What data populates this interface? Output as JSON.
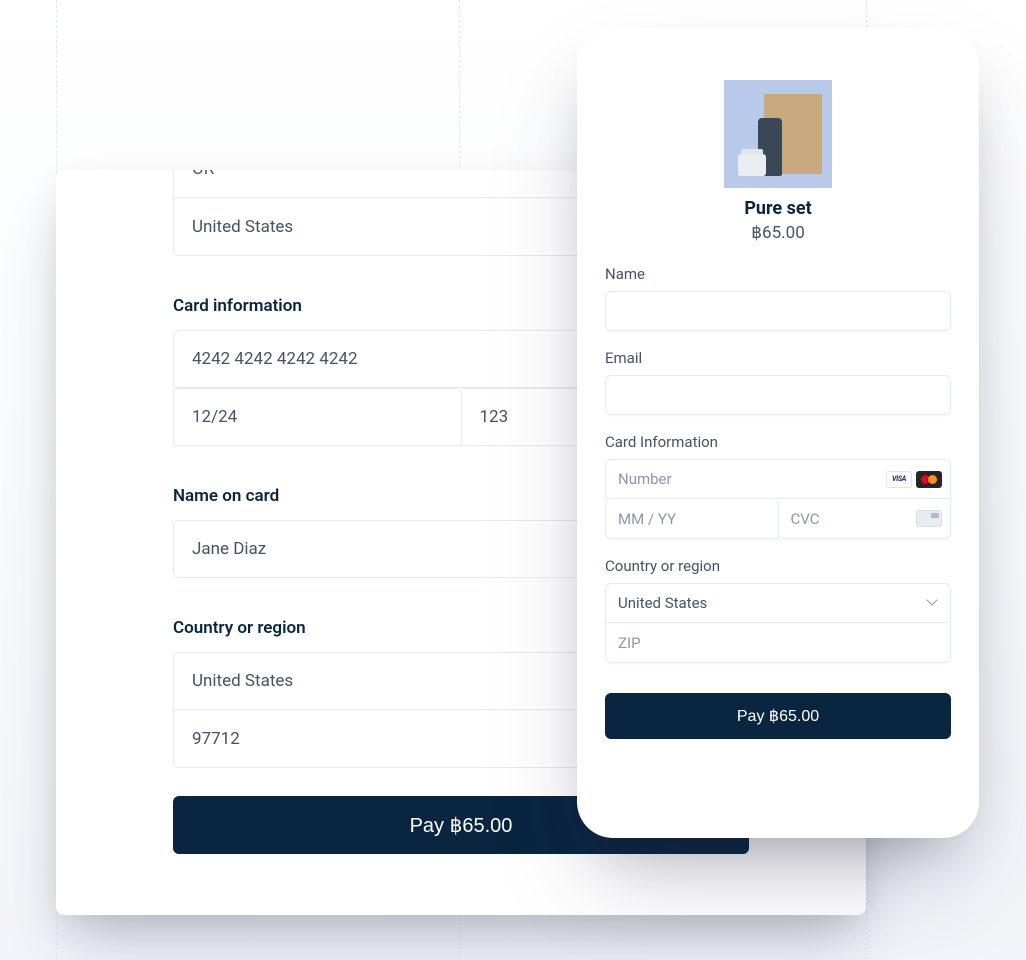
{
  "desktop": {
    "state_value": "OR",
    "country_value_top": "United States",
    "card_info_label": "Card information",
    "card_number_value": "4242 4242 4242 4242",
    "card_expiry_value": "12/24",
    "card_cvc_value": "123",
    "name_label": "Name on card",
    "name_value": "Jane Diaz",
    "country_label": "Country or region",
    "country_value": "United States",
    "zip_value": "97712",
    "pay_label": "Pay ฿65.00"
  },
  "mobile": {
    "product_title": "Pure set",
    "product_price": "฿65.00",
    "name_label": "Name",
    "email_label": "Email",
    "card_info_label": "Card Information",
    "card_number_placeholder": "Number",
    "card_expiry_placeholder": "MM / YY",
    "card_cvc_placeholder": "CVC",
    "country_label": "Country or region",
    "country_value": "United States",
    "zip_placeholder": "ZIP",
    "pay_label": "Pay ฿65.00",
    "visa_text": "VISA"
  }
}
